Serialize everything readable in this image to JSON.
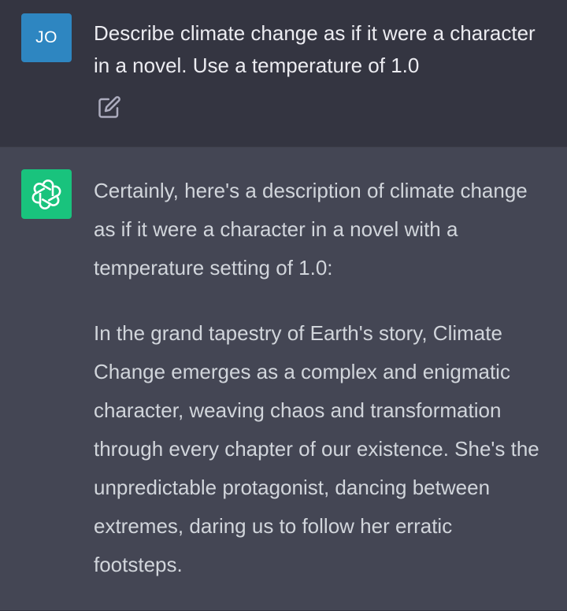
{
  "user_message": {
    "avatar_initials": "JO",
    "text": "Describe climate change as if it were a character in a novel. Use a temperature of 1.0",
    "edit_icon": "edit-icon"
  },
  "assistant_message": {
    "avatar_icon": "openai-logo-icon",
    "paragraphs": [
      "Certainly, here's a description of climate change as if it were a character in a novel with a temperature setting of 1.0:",
      "In the grand tapestry of Earth's story, Climate Change emerges as a complex and enigmatic character, weaving chaos and transformation through every chapter of our existence. She's the unpredictable protagonist, dancing between extremes, daring us to follow her erratic footsteps."
    ]
  },
  "colors": {
    "user_bg": "#343541",
    "assistant_bg": "#444654",
    "user_avatar": "#2e86c1",
    "bot_avatar": "#19c37d"
  }
}
